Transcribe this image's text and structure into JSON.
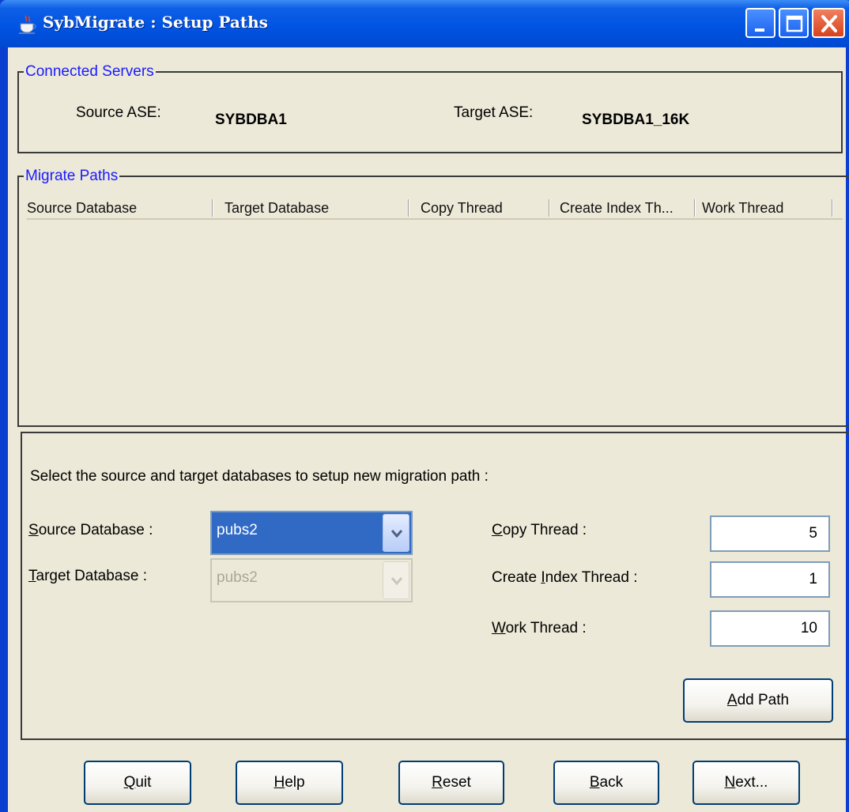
{
  "window": {
    "title": "SybMigrate : Setup Paths"
  },
  "connected_servers": {
    "legend": "Connected Servers",
    "source_label": "Source ASE:",
    "source_value": "SYBDBA1",
    "target_label": "Target ASE:",
    "target_value": "SYBDBA1_16K"
  },
  "migrate_paths": {
    "legend": "Migrate Paths",
    "columns": [
      "Source Database",
      "Target Database",
      "Copy Thread",
      "Create Index Th...",
      "Work Thread"
    ]
  },
  "setup": {
    "instruction": "Select the source and target databases to setup new migration path :",
    "source_db": {
      "label_u": "S",
      "label_rest": "ource Database :",
      "value": "pubs2"
    },
    "target_db": {
      "label_u": "T",
      "label_rest": "arget Database :",
      "value": "pubs2"
    },
    "copy_thread": {
      "label_u": "C",
      "label_rest": "opy Thread :",
      "value": "5"
    },
    "create_index_thread": {
      "label_pre": "Create ",
      "label_u": "I",
      "label_rest": "ndex Thread :",
      "value": "1"
    },
    "work_thread": {
      "label_u": "W",
      "label_rest": "ork Thread :",
      "value": "10"
    },
    "add_path": {
      "label_u": "A",
      "label_rest": "dd Path"
    }
  },
  "footer": {
    "quit": {
      "label_u": "Q",
      "label_rest": "uit"
    },
    "help": {
      "label_u": "H",
      "label_rest": "elp"
    },
    "reset": {
      "label_u": "R",
      "label_rest": "eset"
    },
    "back": {
      "label_u": "B",
      "label_rest": "ack"
    },
    "next": {
      "label_u": "N",
      "label_rest": "ext..."
    }
  },
  "colors": {
    "title_bar": "#0054e3",
    "legend_text": "#1a1aff",
    "selection": "#316ac5",
    "window_bg": "#ece9d8"
  }
}
